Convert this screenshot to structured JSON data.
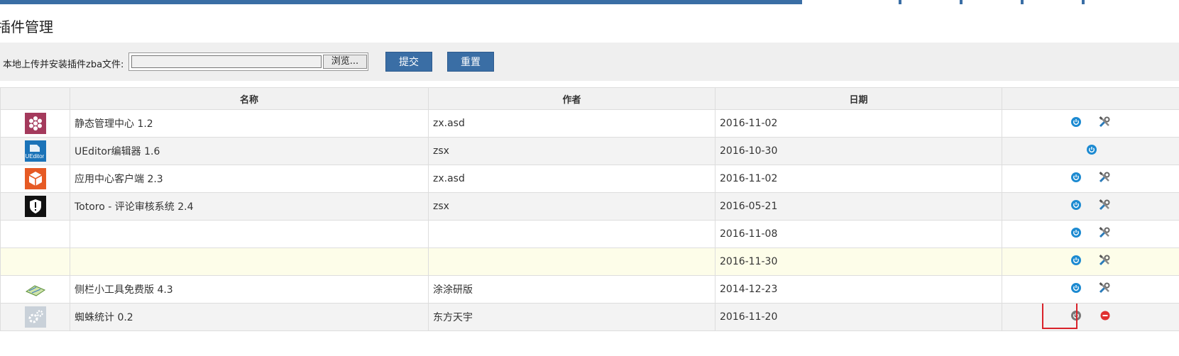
{
  "page": {
    "title": "插件管理"
  },
  "upload": {
    "label": "本地上传并安装插件zba文件:",
    "browse_label": "浏览...",
    "submit_label": "提交",
    "reset_label": "重置"
  },
  "table": {
    "headers": {
      "icon": "",
      "name": "名称",
      "author": "作者",
      "date": "日期",
      "actions": ""
    },
    "rows": [
      {
        "icon": "hexagon-flower-icon",
        "name": "静态管理中心 1.2",
        "author": "zx.asd",
        "date": "2016-11-02"
      },
      {
        "icon": "ueditor-logo-icon",
        "icon_text": "UEditor",
        "name": "UEditor编辑器 1.6",
        "author": "zsx",
        "date": "2016-10-30"
      },
      {
        "icon": "box-icon",
        "name": "应用中心客户端 2.3",
        "author": "zx.asd",
        "date": "2016-11-02"
      },
      {
        "icon": "shield-icon",
        "name": "Totoro - 评论审核系统 2.4",
        "author": "zsx",
        "date": "2016-05-21"
      },
      {
        "icon": "redacted-icon",
        "name": "",
        "author": "",
        "date": "2016-11-08"
      },
      {
        "icon": "redacted-icon",
        "name": "",
        "author": "",
        "date": "2016-11-30"
      },
      {
        "icon": "map-icon",
        "name": "侧栏小工具免费版 4.3",
        "author": "涂涂研版",
        "date": "2014-12-23"
      },
      {
        "icon": "gears-icon",
        "name": "蜘蛛统计 0.2",
        "author": "东方天宇",
        "date": "2016-11-20"
      }
    ]
  },
  "colors": {
    "accent": "#3a6ea5",
    "power_blue": "#1c8ad1",
    "power_gray": "#777777",
    "remove_red": "#e03030",
    "highlight_box": "#d9222a",
    "row_highlight": "#fdfde9"
  }
}
